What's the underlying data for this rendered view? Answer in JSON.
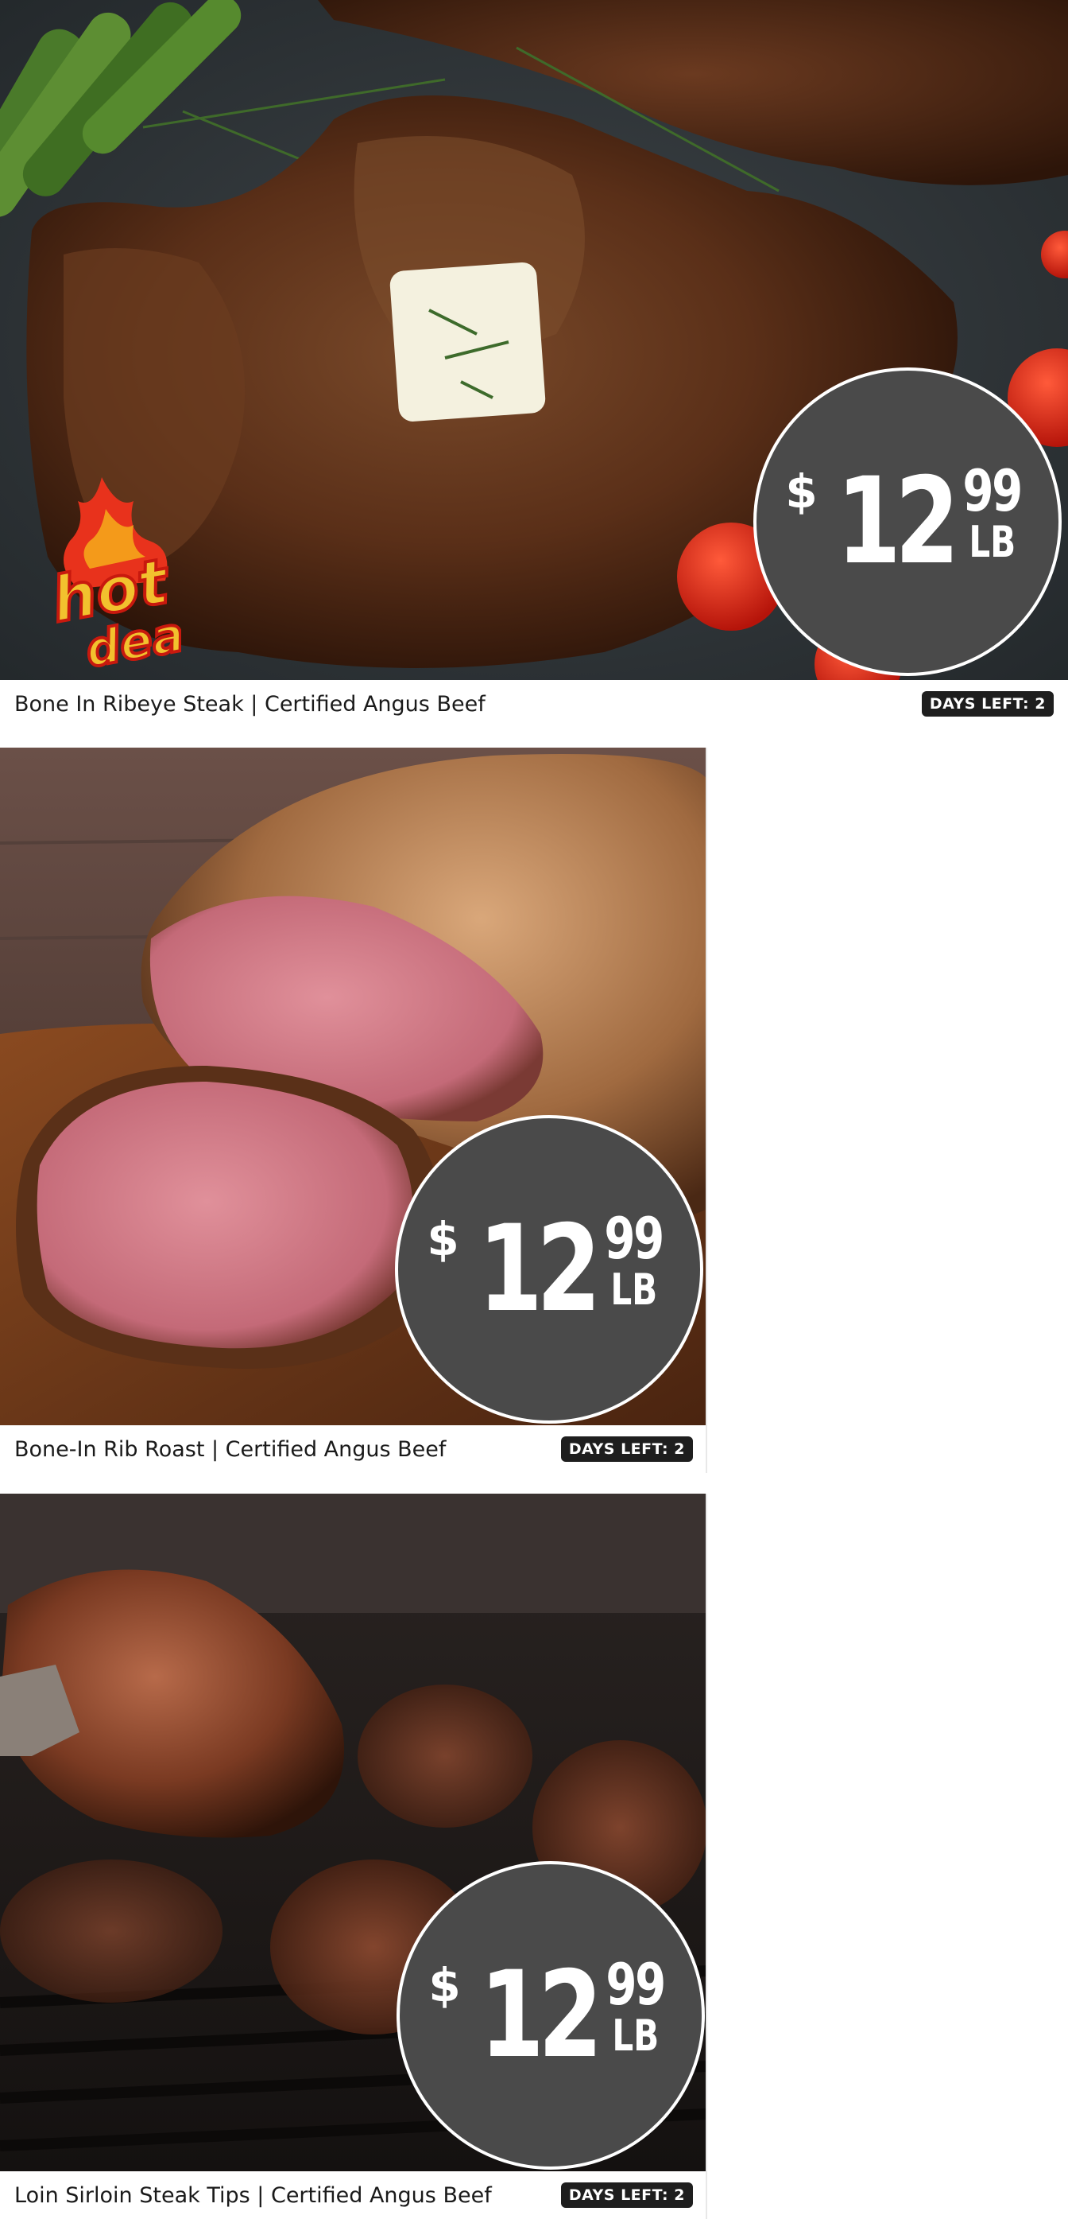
{
  "products": [
    {
      "title": "Bone In Ribeye Steak | Certified Angus Beef",
      "days_left": "DAYS LEFT: 2",
      "price": {
        "currency": "$",
        "dollars": "12",
        "cents": "99",
        "unit": "LB"
      },
      "image": "ribeye-steak-photo",
      "hot_deal": {
        "line1": "hot",
        "line2": "deal"
      }
    },
    {
      "title": "Bone-In Rib Roast | Certified Angus Beef",
      "days_left": "DAYS LEFT: 2",
      "price": {
        "currency": "$",
        "dollars": "12",
        "cents": "99",
        "unit": "LB"
      },
      "image": "rib-roast-photo"
    },
    {
      "title": "Loin Sirloin Steak Tips | Certified Angus Beef",
      "days_left": "DAYS LEFT: 2",
      "price": {
        "currency": "$",
        "dollars": "12",
        "cents": "99",
        "unit": "LB"
      },
      "image": "steak-tips-photo"
    }
  ],
  "colors": {
    "badge_bg": "#4a4a4a",
    "days_badge_bg": "#1e1e1e",
    "hot_flame": "#e8321c",
    "hot_text": "#f2c12e"
  }
}
